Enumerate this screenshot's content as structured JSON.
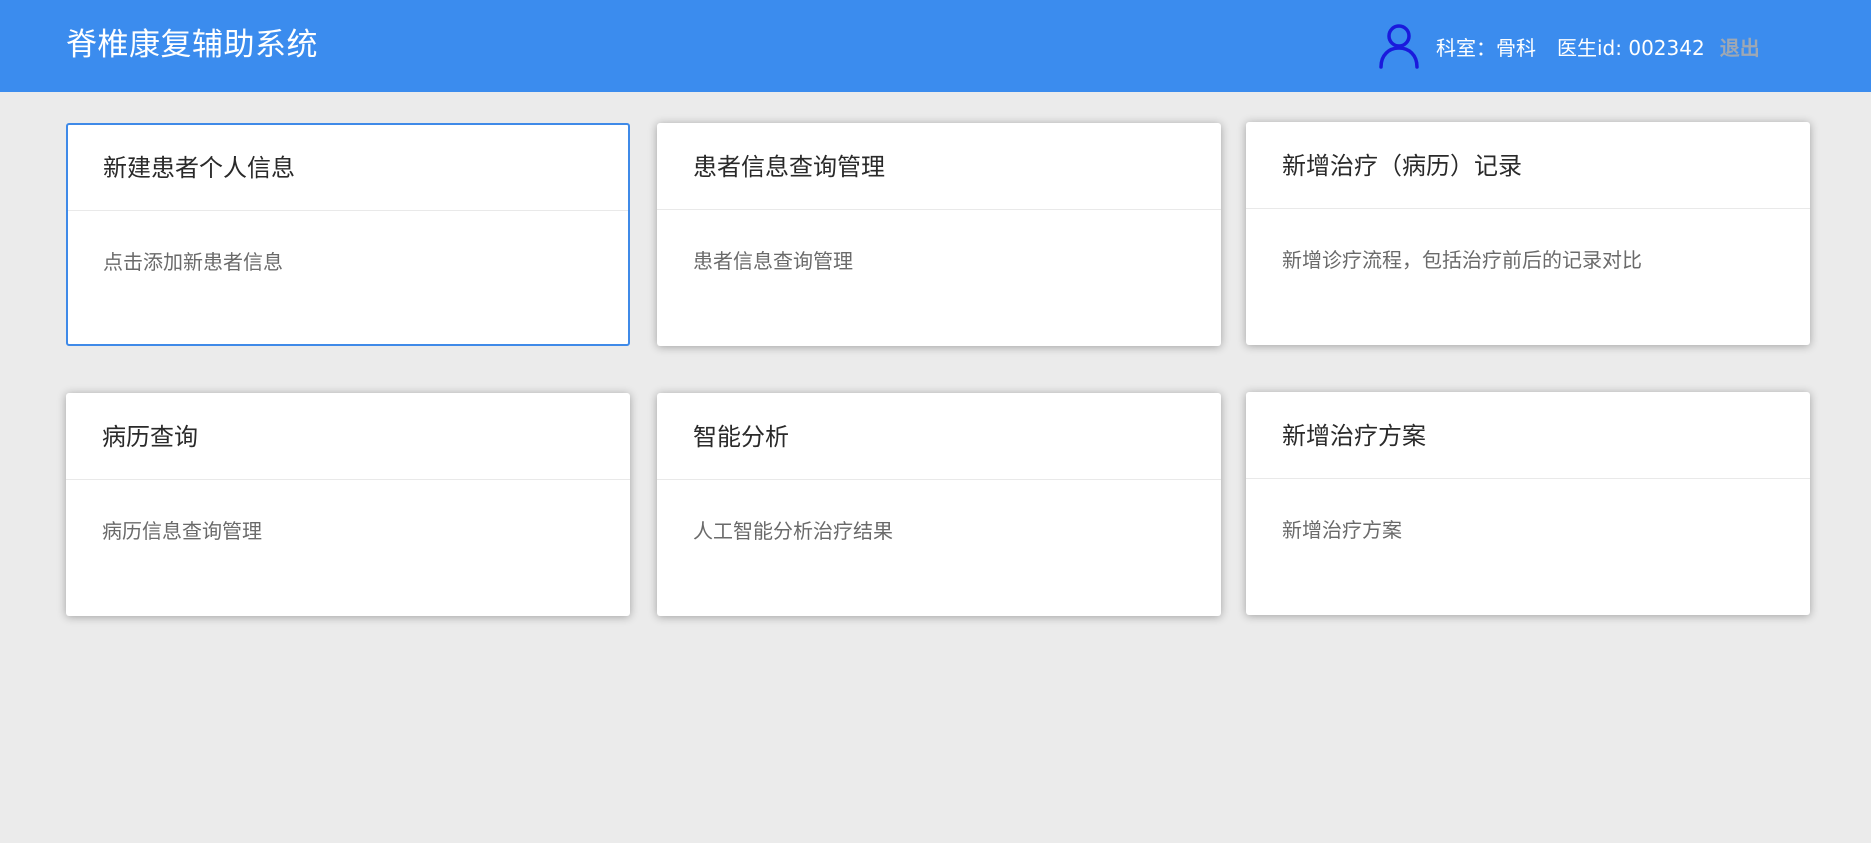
{
  "header": {
    "title": "脊椎康复辅助系统",
    "user_icon": "user-icon",
    "department": "科室：骨科",
    "doctor_id": "医生id: 002342",
    "logout_label": "退出"
  },
  "cards": [
    {
      "title": "新建患者个人信息",
      "desc": "点击添加新患者信息"
    },
    {
      "title": "患者信息查询管理",
      "desc": "患者信息查询管理"
    },
    {
      "title": "新增治疗（病历）记录",
      "desc": "新增诊疗流程，包括治疗前后的记录对比"
    },
    {
      "title": "病历查询",
      "desc": "病历信息查询管理"
    },
    {
      "title": "智能分析",
      "desc": "人工智能分析治疗结果"
    },
    {
      "title": "新增治疗方案",
      "desc": "新增治疗方案"
    }
  ],
  "colors": {
    "header_bg": "#3b8cee",
    "page_bg": "#ebebeb",
    "active_border": "#3f8ae8",
    "user_icon": "#1a1adc",
    "logout": "#9fa8b3"
  }
}
